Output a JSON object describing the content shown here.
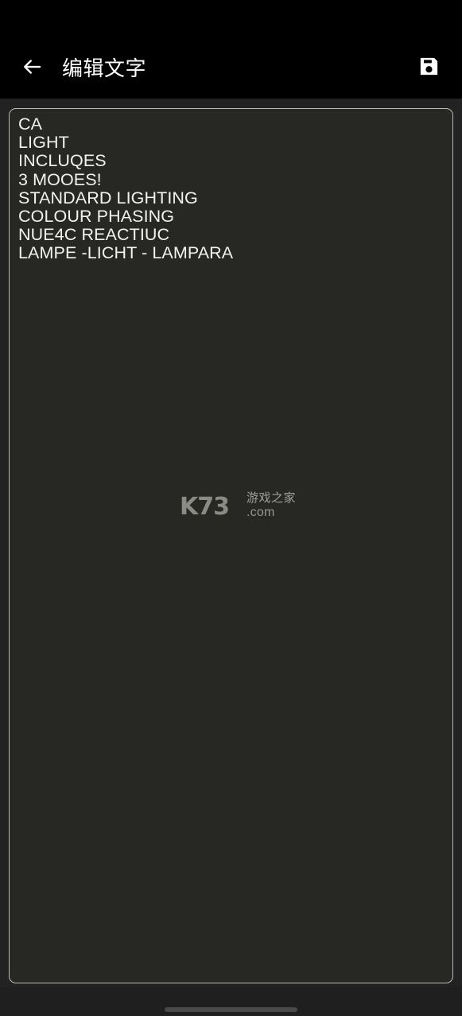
{
  "app_bar": {
    "back_icon": "arrow-left-icon",
    "title": "编辑文字",
    "save_icon": "floppy-disk-save-icon",
    "background_color": "#000000",
    "title_color": "#ffffff"
  },
  "editor": {
    "name": "text-editor",
    "value": "CA\nLIGHT\nINCLUQES\n3 MOOES!\nSTANDARD LIGHTING\nCOLOUR PHASING\nNUE4C REACTIUC\nLAMPE -LICHT - LAMPARA",
    "placeholder": "",
    "lines": [
      "CA",
      "LIGHT",
      "INCLUQES",
      "3 MOOES!",
      "STANDARD LIGHTING",
      "COLOUR PHASING",
      "NUE4C REACTIUC",
      "LAMPE -LICHT - LAMPARA"
    ],
    "background_color": "#272823",
    "border_color": "#b9bbb6",
    "text_color": "#f2f2ef"
  },
  "watermark": {
    "brand": "K73",
    "cn_text": "游戏之家",
    "domain": ".com",
    "color": "#c9c9c4"
  },
  "system": {
    "status_bar_color": "#000000",
    "page_background": "#222222",
    "gesture_bar_color": "#4a4a4a"
  }
}
